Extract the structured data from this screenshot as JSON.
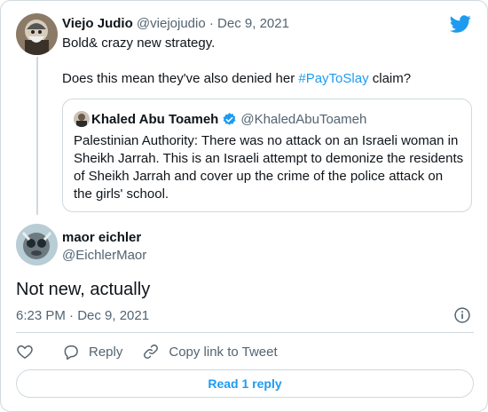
{
  "original_tweet": {
    "display_name": "Viejo Judio",
    "handle": "@viejojudio",
    "separator": "·",
    "date": "Dec 9, 2021",
    "text_line1": "Bold& crazy new strategy.",
    "text_line2_prefix": "Does this mean they've also denied her ",
    "hashtag": "#PayToSlay",
    "text_line2_suffix": " claim?"
  },
  "quoted_tweet": {
    "display_name": "Khaled Abu Toameh",
    "handle": "@KhaledAbuToameh",
    "text": "Palestinian Authority: There was no attack on an Israeli woman in Sheikh Jarrah. This is an Israeli attempt to demonize the residents of Sheikh Jarrah and cover up the crime of the police attack on the girls' school."
  },
  "reply_tweet": {
    "display_name": "maor eichler",
    "handle": "@EichlerMaor",
    "text": "Not new, actually",
    "timestamp": "6:23 PM · Dec 9, 2021"
  },
  "actions": {
    "reply_label": "Reply",
    "copy_label": "Copy link to Tweet"
  },
  "read_replies_label": "Read 1 reply",
  "icons": {
    "brand": "twitter-bird-icon",
    "verified": "verified-badge-icon",
    "info": "info-icon",
    "like": "heart-icon",
    "reply": "reply-bubble-icon",
    "copy": "link-icon"
  },
  "colors": {
    "accent": "#1d9bf0",
    "text": "#0f1419",
    "muted": "#536471",
    "border": "#cfd9de"
  }
}
